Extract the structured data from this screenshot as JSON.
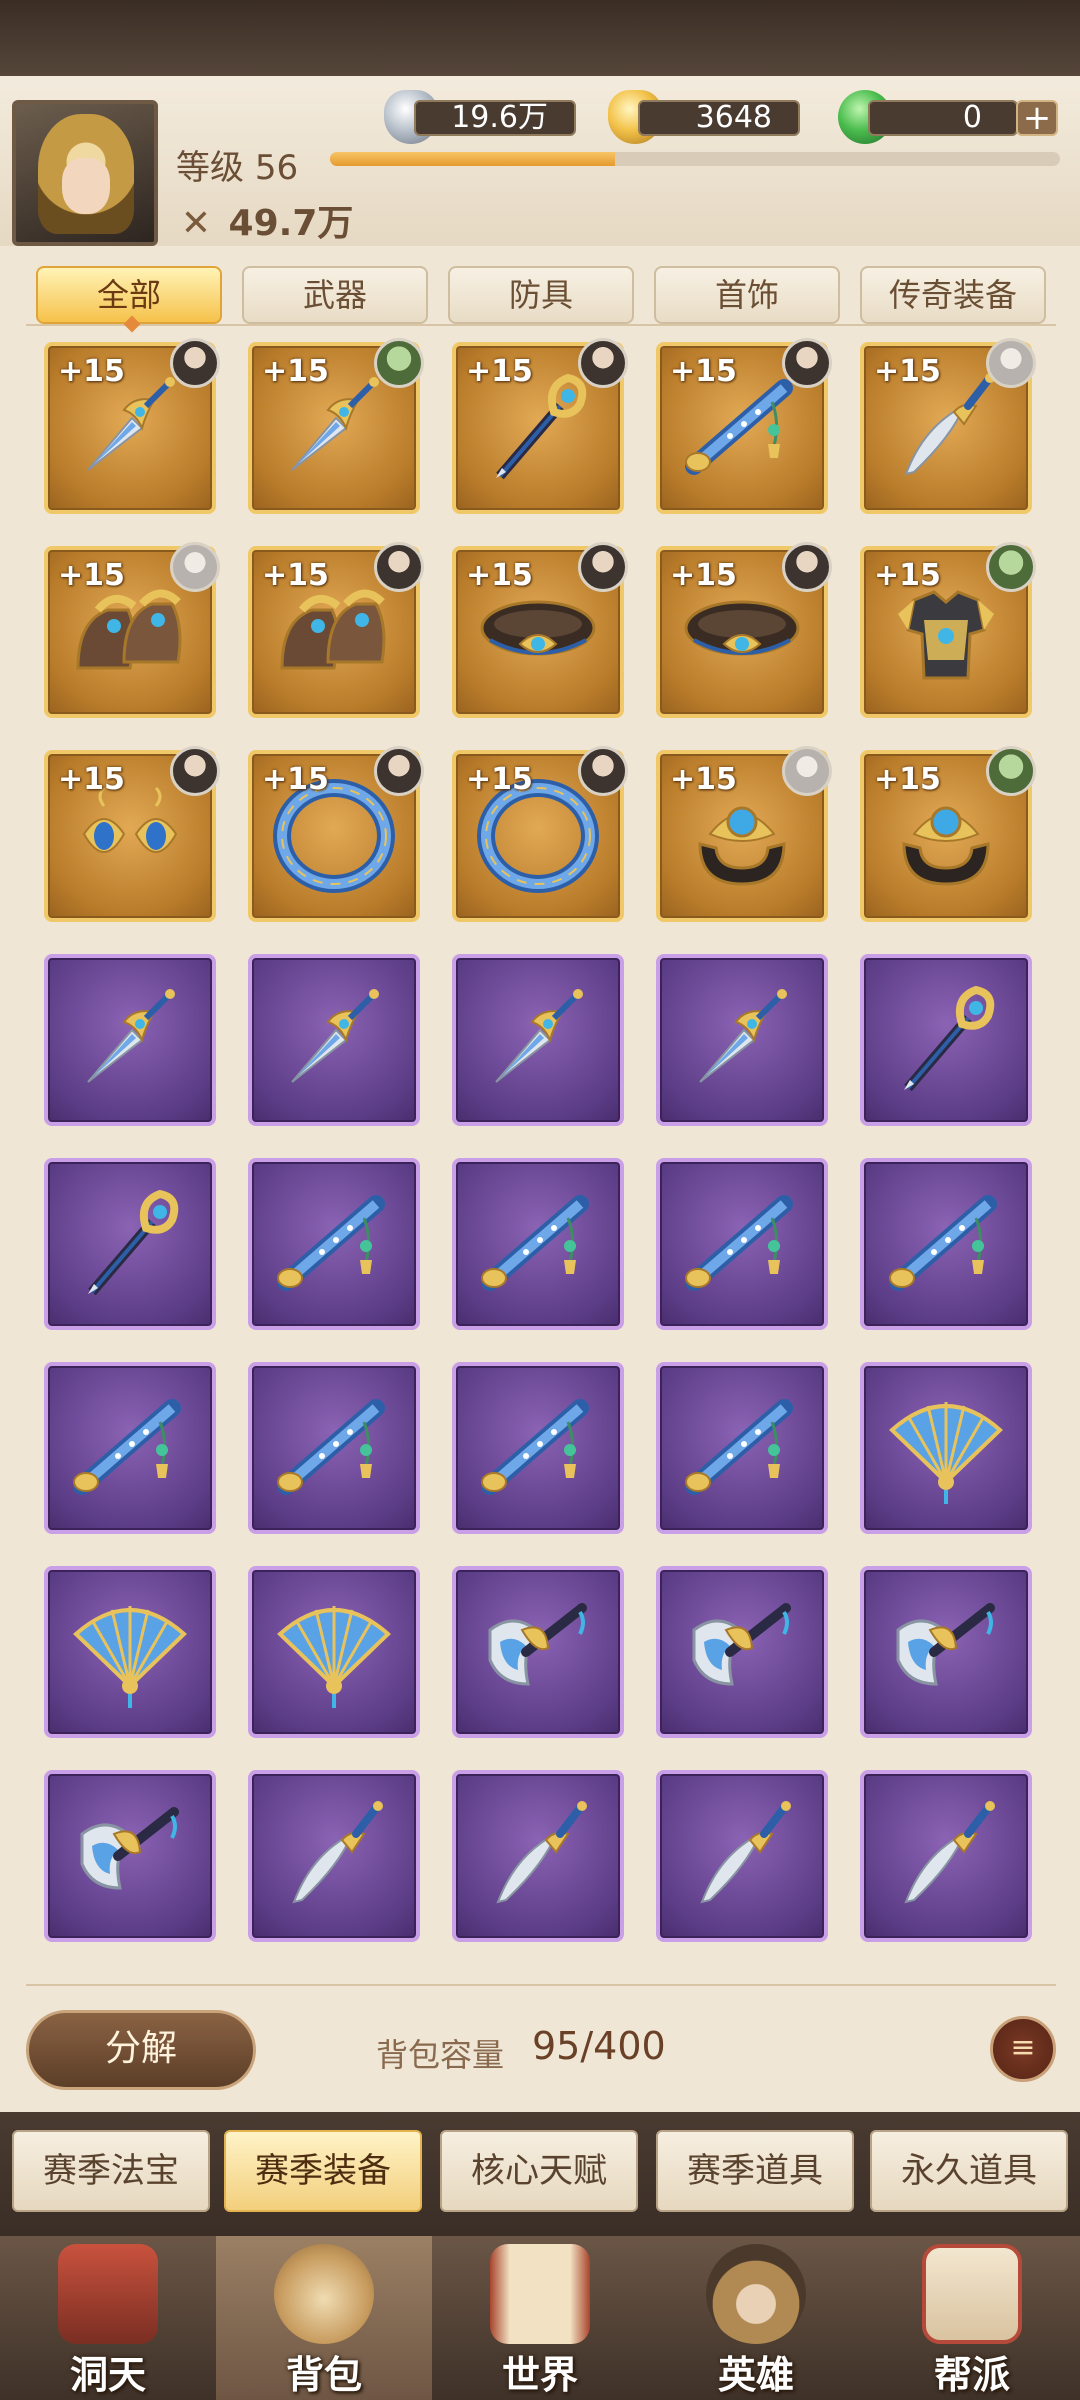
{
  "header": {
    "level_label": "等级",
    "level": "56",
    "xp_fraction": 0.39,
    "power_icon": "crossed-swords-icon",
    "power": "49.7万",
    "resources": [
      {
        "name": "silver",
        "icon": "silver-ingot-icon",
        "value": "19.6万"
      },
      {
        "name": "gold",
        "icon": "gold-ingot-icon",
        "value": "3648"
      },
      {
        "name": "jade",
        "icon": "jade-dragon-icon",
        "value": "0"
      }
    ],
    "plus_label": "+"
  },
  "category_tabs": [
    "全部",
    "武器",
    "防具",
    "首饰",
    "传奇装备"
  ],
  "active_category": 0,
  "equipment": [
    {
      "rarity": "gold",
      "level": "+15",
      "icon": "dagger-icon",
      "owner": "dark"
    },
    {
      "rarity": "gold",
      "level": "+15",
      "icon": "dagger-icon",
      "owner": "green"
    },
    {
      "rarity": "gold",
      "level": "+15",
      "icon": "staff-icon",
      "owner": "dark"
    },
    {
      "rarity": "gold",
      "level": "+15",
      "icon": "flute-icon",
      "owner": "dark"
    },
    {
      "rarity": "gold",
      "level": "+15",
      "icon": "curved-blade-icon",
      "owner": "silver"
    },
    {
      "rarity": "gold",
      "level": "+15",
      "icon": "boots-icon",
      "owner": "silver"
    },
    {
      "rarity": "gold",
      "level": "+15",
      "icon": "boots-icon",
      "owner": "dark"
    },
    {
      "rarity": "gold",
      "level": "+15",
      "icon": "belt-icon",
      "owner": "dark"
    },
    {
      "rarity": "gold",
      "level": "+15",
      "icon": "belt-icon",
      "owner": "dark"
    },
    {
      "rarity": "gold",
      "level": "+15",
      "icon": "armor-icon",
      "owner": "green"
    },
    {
      "rarity": "gold",
      "level": "+15",
      "icon": "earrings-icon",
      "owner": "dark"
    },
    {
      "rarity": "gold",
      "level": "+15",
      "icon": "bracelet-icon",
      "owner": "dark"
    },
    {
      "rarity": "gold",
      "level": "+15",
      "icon": "bracelet-icon",
      "owner": "dark"
    },
    {
      "rarity": "gold",
      "level": "+15",
      "icon": "ring-icon",
      "owner": "silver"
    },
    {
      "rarity": "gold",
      "level": "+15",
      "icon": "ring-icon",
      "owner": "green"
    },
    {
      "rarity": "purple",
      "icon": "dagger-icon"
    },
    {
      "rarity": "purple",
      "icon": "dagger-icon"
    },
    {
      "rarity": "purple",
      "icon": "dagger-icon"
    },
    {
      "rarity": "purple",
      "icon": "dagger-icon"
    },
    {
      "rarity": "purple",
      "icon": "staff-icon"
    },
    {
      "rarity": "purple",
      "icon": "staff-icon"
    },
    {
      "rarity": "purple",
      "icon": "flute-icon"
    },
    {
      "rarity": "purple",
      "icon": "flute-icon"
    },
    {
      "rarity": "purple",
      "icon": "flute-icon"
    },
    {
      "rarity": "purple",
      "icon": "flute-icon"
    },
    {
      "rarity": "purple",
      "icon": "flute-icon"
    },
    {
      "rarity": "purple",
      "icon": "flute-icon"
    },
    {
      "rarity": "purple",
      "icon": "flute-icon"
    },
    {
      "rarity": "purple",
      "icon": "flute-icon"
    },
    {
      "rarity": "purple",
      "icon": "fan-icon"
    },
    {
      "rarity": "purple",
      "icon": "fan-icon"
    },
    {
      "rarity": "purple",
      "icon": "fan-icon"
    },
    {
      "rarity": "purple",
      "icon": "axe-icon"
    },
    {
      "rarity": "purple",
      "icon": "axe-icon"
    },
    {
      "rarity": "purple",
      "icon": "axe-icon"
    },
    {
      "rarity": "purple",
      "icon": "axe-icon"
    },
    {
      "rarity": "purple",
      "icon": "curved-blade-icon"
    },
    {
      "rarity": "purple",
      "icon": "curved-blade-icon"
    },
    {
      "rarity": "purple",
      "icon": "curved-blade-icon"
    },
    {
      "rarity": "purple",
      "icon": "curved-blade-icon"
    }
  ],
  "footer": {
    "decompose_label": "分解",
    "capacity_label": "背包容量",
    "capacity_value": "95/400",
    "filter_icon": "filter-icon"
  },
  "sub_tabs": [
    "赛季法宝",
    "赛季装备",
    "核心天赋",
    "赛季道具",
    "永久道具"
  ],
  "active_sub_tab": 1,
  "nav": [
    {
      "label": "洞天",
      "icon": "pavilion-icon"
    },
    {
      "label": "背包",
      "icon": "bag-icon"
    },
    {
      "label": "世界",
      "icon": "scroll-icon"
    },
    {
      "label": "英雄",
      "icon": "hero-icon"
    },
    {
      "label": "帮派",
      "icon": "banner-icon"
    }
  ],
  "active_nav": 1,
  "colors": {
    "gold_slot": "#b97c2a",
    "purple_slot": "#5b3c86",
    "accent": "#f6c24b"
  }
}
